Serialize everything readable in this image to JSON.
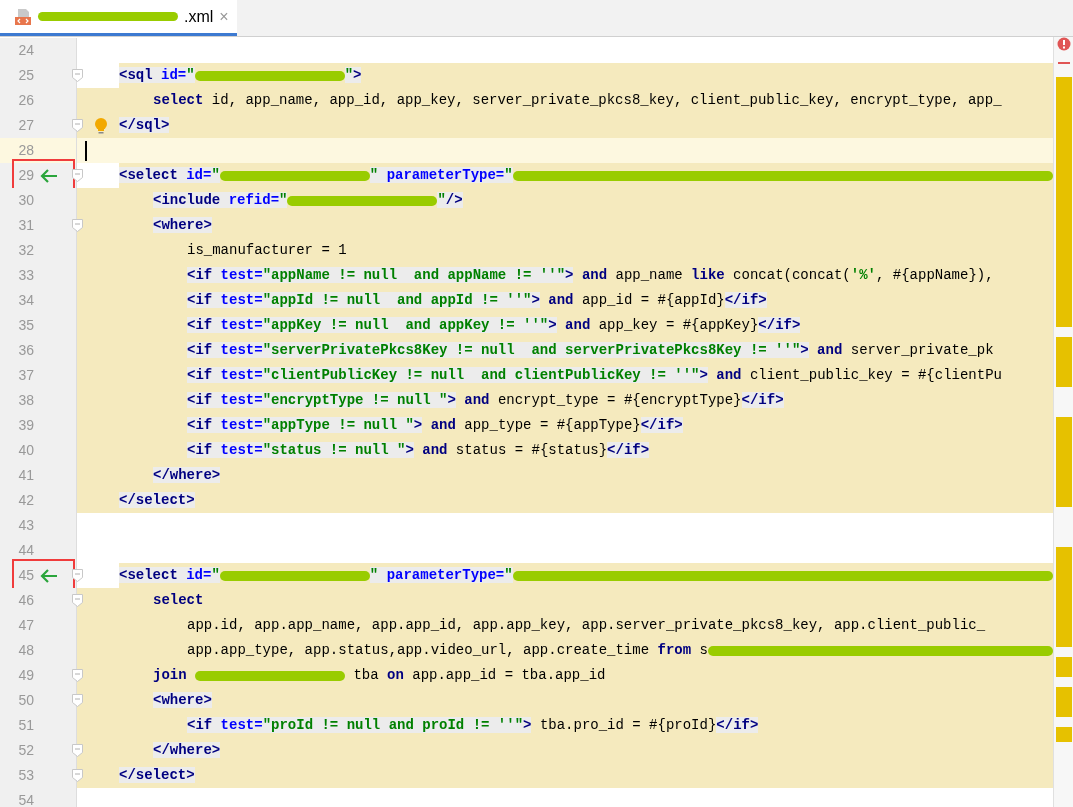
{
  "tab": {
    "redacted_name": true,
    "label": ".xml",
    "selected": true,
    "close": "×"
  },
  "lines": [
    {
      "number": "24",
      "highlighted": false
    },
    {
      "number": "25",
      "highlighted": true,
      "margin_highlighted": false,
      "fold": true,
      "tokens": [
        {
          "kind": "tag",
          "text": "<sql "
        },
        {
          "kind": "attr",
          "text": "id="
        },
        {
          "kind": "string",
          "text": "\""
        },
        {
          "kind": "redacted"
        },
        {
          "kind": "string",
          "text": "\""
        },
        {
          "kind": "tag",
          "text": ">"
        }
      ],
      "children": [
        {
          "number": "26",
          "highlighted": true,
          "margin_highlighted": true,
          "tokens": [
            {
              "kind": "keyword",
              "text": "select"
            },
            {
              "kind": "plain",
              "text": " id, app_name, app_id, app_key, server_private_pkcs8_key, client_public_key, encrypt_type, app_"
            }
          ]
        }
      ]
    },
    {
      "number": "27",
      "highlighted": true,
      "margin_highlighted": true,
      "fold": true,
      "bulb": true,
      "tokens": [
        {
          "kind": "tag",
          "text": "</sql>"
        }
      ]
    },
    {
      "number": "28",
      "highlighted": false,
      "current": true,
      "caret": true
    },
    {
      "number": "29",
      "highlighted": true,
      "margin_highlighted": false,
      "fold": true,
      "arrow": true,
      "boxed": true,
      "tokens": [
        {
          "kind": "tag",
          "text": "<select "
        },
        {
          "kind": "attr",
          "text": "id="
        },
        {
          "kind": "string",
          "text": "\""
        },
        {
          "kind": "redacted"
        },
        {
          "kind": "string",
          "text": "\" "
        },
        {
          "kind": "attr",
          "text": "parameterType="
        },
        {
          "kind": "string",
          "text": "\""
        },
        {
          "kind": "redacted"
        }
      ],
      "children": [
        {
          "number": "30",
          "highlighted": true,
          "margin_highlighted": true,
          "tokens": [
            {
              "kind": "tag",
              "text": "<include "
            },
            {
              "kind": "attr",
              "text": "refid="
            },
            {
              "kind": "string",
              "text": "\""
            },
            {
              "kind": "redacted"
            },
            {
              "kind": "string",
              "text": "\""
            },
            {
              "kind": "tag",
              "text": "/>"
            }
          ]
        },
        {
          "number": "31",
          "highlighted": true,
          "margin_highlighted": true,
          "fold": true,
          "tokens": [
            {
              "kind": "tag",
              "text": "<where>"
            }
          ],
          "children": [
            {
              "number": "32",
              "highlighted": true,
              "margin_highlighted": true,
              "tokens": [
                {
                  "kind": "plain",
                  "text": "is_manufacturer = 1"
                }
              ]
            },
            {
              "number": "33",
              "highlighted": true,
              "margin_highlighted": true,
              "tokens": [
                {
                  "kind": "tag",
                  "text": "<if "
                },
                {
                  "kind": "attr",
                  "text": "test="
                },
                {
                  "kind": "string",
                  "text": "\"appName != null  and appName != ''\""
                },
                {
                  "kind": "tag",
                  "text": ">"
                },
                {
                  "kind": "keyword",
                  "text": " and"
                },
                {
                  "kind": "plain",
                  "text": " app_name "
                },
                {
                  "kind": "keyword",
                  "text": "like"
                },
                {
                  "kind": "plain",
                  "text": " concat(concat("
                },
                {
                  "kind": "sql_string",
                  "text": "'%'"
                },
                {
                  "kind": "plain",
                  "text": ", #{appName}),"
                }
              ]
            },
            {
              "number": "34",
              "highlighted": true,
              "margin_highlighted": true,
              "tokens": [
                {
                  "kind": "tag",
                  "text": "<if "
                },
                {
                  "kind": "attr",
                  "text": "test="
                },
                {
                  "kind": "string",
                  "text": "\"appId != null  and appId != ''\""
                },
                {
                  "kind": "tag",
                  "text": ">"
                },
                {
                  "kind": "keyword",
                  "text": " and"
                },
                {
                  "kind": "plain",
                  "text": " app_id = #{appId}"
                },
                {
                  "kind": "tag",
                  "text": "</if>"
                }
              ]
            },
            {
              "number": "35",
              "highlighted": true,
              "margin_highlighted": true,
              "tokens": [
                {
                  "kind": "tag",
                  "text": "<if "
                },
                {
                  "kind": "attr",
                  "text": "test="
                },
                {
                  "kind": "string",
                  "text": "\"appKey != null  and appKey != ''\""
                },
                {
                  "kind": "tag",
                  "text": ">"
                },
                {
                  "kind": "keyword",
                  "text": " and"
                },
                {
                  "kind": "plain",
                  "text": " app_key = #{appKey}"
                },
                {
                  "kind": "tag",
                  "text": "</if>"
                }
              ]
            },
            {
              "number": "36",
              "highlighted": true,
              "margin_highlighted": true,
              "tokens": [
                {
                  "kind": "tag",
                  "text": "<if "
                },
                {
                  "kind": "attr",
                  "text": "test="
                },
                {
                  "kind": "string",
                  "text": "\"serverPrivatePkcs8Key != null  and serverPrivatePkcs8Key != ''\""
                },
                {
                  "kind": "tag",
                  "text": ">"
                },
                {
                  "kind": "keyword",
                  "text": " and"
                },
                {
                  "kind": "plain",
                  "text": " server_private_pk"
                }
              ]
            },
            {
              "number": "37",
              "highlighted": true,
              "margin_highlighted": true,
              "tokens": [
                {
                  "kind": "tag",
                  "text": "<if "
                },
                {
                  "kind": "attr",
                  "text": "test="
                },
                {
                  "kind": "string",
                  "text": "\"clientPublicKey != null  and clientPublicKey != ''\""
                },
                {
                  "kind": "tag",
                  "text": ">"
                },
                {
                  "kind": "keyword",
                  "text": " and"
                },
                {
                  "kind": "plain",
                  "text": " client_public_key = #{clientPu"
                }
              ]
            },
            {
              "number": "38",
              "highlighted": true,
              "margin_highlighted": true,
              "tokens": [
                {
                  "kind": "tag",
                  "text": "<if "
                },
                {
                  "kind": "attr",
                  "text": "test="
                },
                {
                  "kind": "string",
                  "text": "\"encryptType != null \""
                },
                {
                  "kind": "tag",
                  "text": ">"
                },
                {
                  "kind": "keyword",
                  "text": " and"
                },
                {
                  "kind": "plain",
                  "text": " encrypt_type = #{encryptType}"
                },
                {
                  "kind": "tag",
                  "text": "</if>"
                }
              ]
            },
            {
              "number": "39",
              "highlighted": true,
              "margin_highlighted": true,
              "tokens": [
                {
                  "kind": "tag",
                  "text": "<if "
                },
                {
                  "kind": "attr",
                  "text": "test="
                },
                {
                  "kind": "string",
                  "text": "\"appType != null \""
                },
                {
                  "kind": "tag",
                  "text": ">"
                },
                {
                  "kind": "keyword",
                  "text": " and"
                },
                {
                  "kind": "plain",
                  "text": " app_type = #{appType}"
                },
                {
                  "kind": "tag",
                  "text": "</if>"
                }
              ]
            },
            {
              "number": "40",
              "highlighted": true,
              "margin_highlighted": true,
              "tokens": [
                {
                  "kind": "tag",
                  "text": "<if "
                },
                {
                  "kind": "attr",
                  "text": "test="
                },
                {
                  "kind": "string",
                  "text": "\"status != null \""
                },
                {
                  "kind": "tag",
                  "text": ">"
                },
                {
                  "kind": "keyword",
                  "text": " and"
                },
                {
                  "kind": "plain",
                  "text": " status = #{status}"
                },
                {
                  "kind": "tag",
                  "text": "</if>"
                }
              ]
            }
          ]
        },
        {
          "number": "41",
          "highlighted": true,
          "margin_highlighted": true,
          "tokens": [
            {
              "kind": "tag",
              "text": "</where>"
            }
          ]
        }
      ]
    },
    {
      "number": "42",
      "highlighted": true,
      "margin_highlighted": true,
      "tokens": [
        {
          "kind": "tag",
          "text": "</select>"
        }
      ]
    },
    {
      "number": "43",
      "highlighted": false
    },
    {
      "number": "44",
      "highlighted": false
    },
    {
      "number": "45",
      "highlighted": true,
      "margin_highlighted": false,
      "fold": true,
      "arrow": true,
      "boxed": true,
      "tokens": [
        {
          "kind": "tag",
          "text": "<select "
        },
        {
          "kind": "attr",
          "text": "id="
        },
        {
          "kind": "string",
          "text": "\""
        },
        {
          "kind": "redacted"
        },
        {
          "kind": "string",
          "text": "\" "
        },
        {
          "kind": "attr",
          "text": "parameterType="
        },
        {
          "kind": "string",
          "text": "\""
        },
        {
          "kind": "redacted"
        }
      ],
      "children": [
        {
          "number": "46",
          "highlighted": true,
          "margin_highlighted": true,
          "fold": true,
          "tokens": [
            {
              "kind": "keyword",
              "text": "select"
            }
          ],
          "children": [
            {
              "number": "47",
              "highlighted": true,
              "margin_highlighted": true,
              "tokens": [
                {
                  "kind": "plain",
                  "text": "app.id, app.app_name, app.app_id, app.app_key, app.server_private_pkcs8_key, app.client_public_"
                }
              ]
            },
            {
              "number": "48",
              "highlighted": true,
              "margin_highlighted": true,
              "tokens": [
                {
                  "kind": "plain",
                  "text": "app.app_type, app.status,app.video_url, app.create_time "
                },
                {
                  "kind": "keyword",
                  "text": "from"
                },
                {
                  "kind": "plain",
                  "text": " s"
                },
                {
                  "kind": "redacted"
                }
              ]
            }
          ]
        },
        {
          "number": "49",
          "highlighted": true,
          "margin_highlighted": true,
          "fold": true,
          "tokens": [
            {
              "kind": "keyword",
              "text": "join "
            },
            {
              "kind": "redacted"
            },
            {
              "kind": "plain",
              "text": " tba "
            },
            {
              "kind": "keyword",
              "text": "on"
            },
            {
              "kind": "plain",
              "text": " app.app_id = tba.app_id"
            }
          ]
        },
        {
          "number": "50",
          "highlighted": true,
          "margin_highlighted": true,
          "fold": true,
          "tokens": [
            {
              "kind": "tag",
              "text": "<where>"
            }
          ],
          "children": [
            {
              "number": "51",
              "highlighted": true,
              "margin_highlighted": true,
              "tokens": [
                {
                  "kind": "tag",
                  "text": "<if "
                },
                {
                  "kind": "attr",
                  "text": "test="
                },
                {
                  "kind": "string",
                  "text": "\"proId != null and proId != ''\""
                },
                {
                  "kind": "tag",
                  "text": ">"
                },
                {
                  "kind": "plain",
                  "text": " tba.pro_id = #{proId}"
                },
                {
                  "kind": "tag",
                  "text": "</if>"
                }
              ]
            }
          ]
        },
        {
          "number": "52",
          "highlighted": true,
          "margin_highlighted": true,
          "fold": true,
          "tokens": [
            {
              "kind": "tag",
              "text": "</where>"
            }
          ]
        }
      ]
    },
    {
      "number": "53",
      "highlighted": true,
      "margin_highlighted": true,
      "fold": true,
      "tokens": [
        {
          "kind": "tag",
          "text": "</select>"
        }
      ]
    },
    {
      "number": "54",
      "highlighted": false
    }
  ]
}
